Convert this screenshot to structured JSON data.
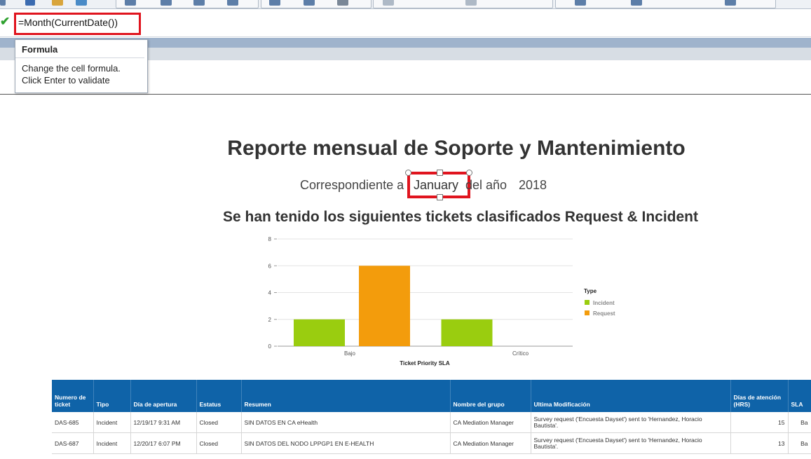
{
  "formula": {
    "value": "=Month(CurrentDate())"
  },
  "tooltip": {
    "title": "Formula",
    "line1": "Change the cell formula.",
    "line2": "Click Enter to validate"
  },
  "report": {
    "title": "Reporte mensual de Soporte y Mantenimiento",
    "subtitle_prefix": "Correspondiente a",
    "month": "January",
    "subtitle_mid": "del año",
    "year": "2018",
    "section_title": "Se han tenido los siguientes tickets clasificados Request & Incident"
  },
  "chart_data": {
    "type": "bar",
    "xlabel": "Ticket Priority SLA",
    "ylabel": "",
    "ylim": [
      0,
      8
    ],
    "yticks": [
      0,
      2,
      4,
      6,
      8
    ],
    "categories": [
      "Bajo",
      "Crítico"
    ],
    "legend_title": "Type",
    "legend_position": "right",
    "grid": true,
    "series": [
      {
        "name": "Incident",
        "color": "#9acd0f",
        "values": [
          2,
          2
        ]
      },
      {
        "name": "Request",
        "color": "#f39c0c",
        "values": [
          6,
          0
        ]
      }
    ]
  },
  "table": {
    "headers": [
      "Numero de ticket",
      "Tipo",
      "Día de apertura",
      "Estatus",
      "Resumen",
      "Nombre del grupo",
      "Ultima Modificación",
      "Días de atención (HRS)",
      "SLA"
    ],
    "rows": [
      [
        "DAS-685",
        "Incident",
        "12/19/17 9:31 AM",
        "Closed",
        "SIN DATOS EN CA eHealth",
        "CA Mediation Manager",
        "Survey request ('Encuesta Dayset') sent to 'Hernandez, Horacio Bautista'.",
        "15",
        "Ba"
      ],
      [
        "DAS-687",
        "Incident",
        "12/20/17 6:07 PM",
        "Closed",
        "SIN DATOS DEL NODO LPPGP1 EN E-HEALTH",
        "CA Mediation Manager",
        "Survey request ('Encuesta Dayset') sent to 'Hernandez, Horacio Bautista'.",
        "13",
        "Ba"
      ]
    ]
  }
}
